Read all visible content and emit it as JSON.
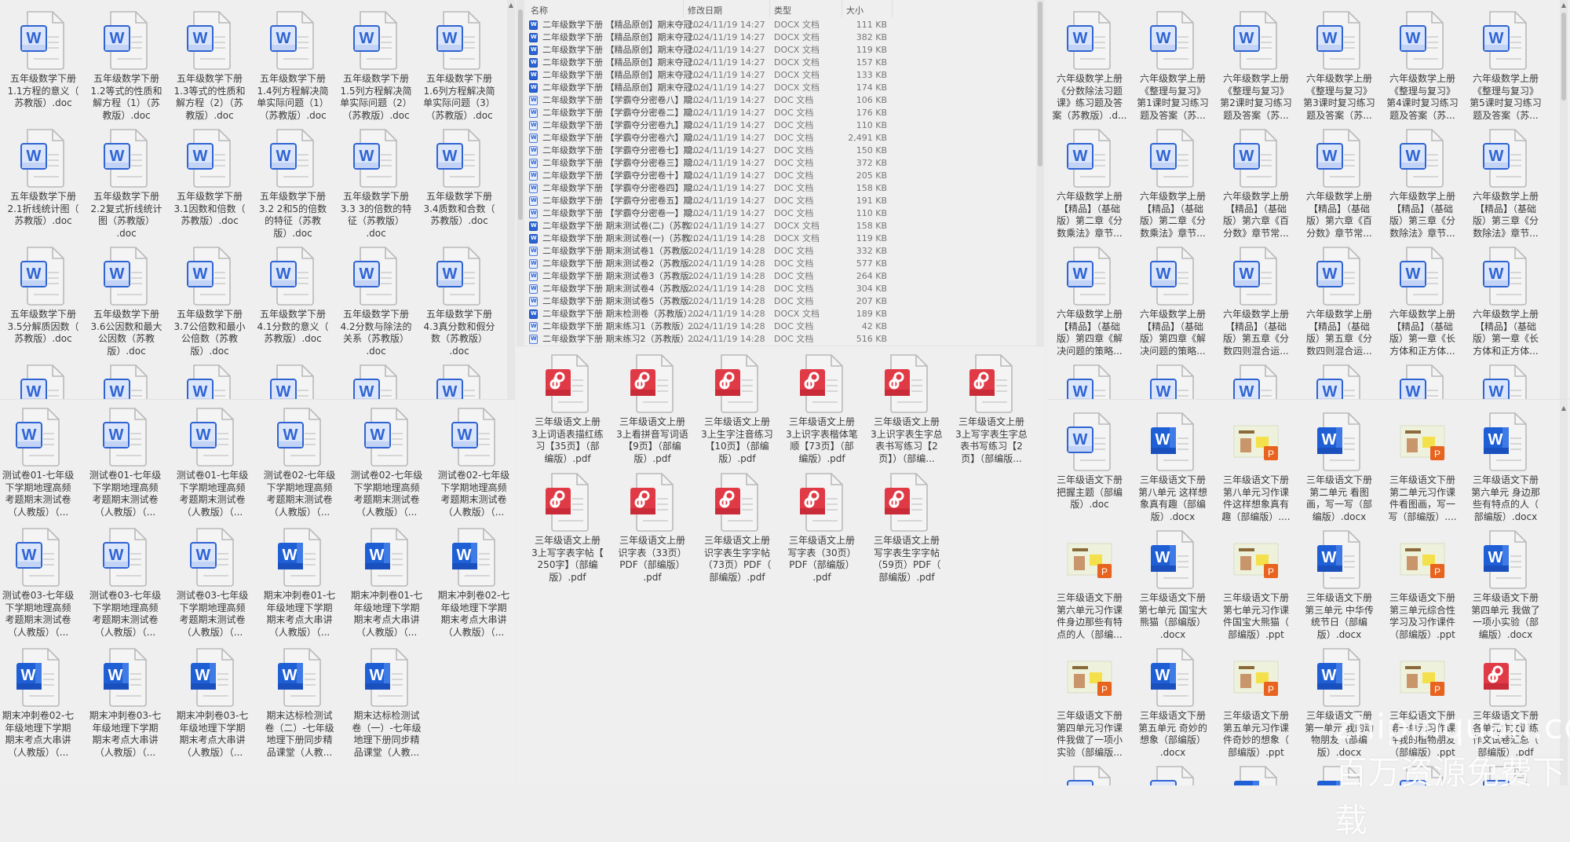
{
  "colors": {
    "word_blue": "#2f64d2",
    "pdf_red": "#e03a46",
    "ppt_orange": "#e8631f",
    "background": "#efefef"
  },
  "left_top": {
    "items": [
      {
        "icon": "word-light",
        "name": "五年级数学下册\n1.1方程的意义（\n苏教版）.doc"
      },
      {
        "icon": "word-light",
        "name": "五年级数学下册\n1.2等式的性质和\n解方程（1）（苏\n教版）.doc"
      },
      {
        "icon": "word-light",
        "name": "五年级数学下册\n1.3等式的性质和\n解方程（2）（苏\n教版）.doc"
      },
      {
        "icon": "word-light",
        "name": "五年级数学下册\n1.4列方程解决简\n单实际问题（1）\n（苏教版）.doc"
      },
      {
        "icon": "word-light",
        "name": "五年级数学下册\n1.5列方程解决简\n单实际问题（2）\n（苏教版）.doc"
      },
      {
        "icon": "word-light",
        "name": "五年级数学下册\n1.6列方程解决简\n单实际问题（3）\n（苏教版）.doc"
      },
      {
        "icon": "word-light",
        "name": "五年级数学下册\n2.1折线统计图（\n苏教版）.doc"
      },
      {
        "icon": "word-light",
        "name": "五年级数学下册\n2.2复式折线统计\n图（苏教版）\n.doc"
      },
      {
        "icon": "word-light",
        "name": "五年级数学下册\n3.1因数和倍数（\n苏教版）.doc"
      },
      {
        "icon": "word-light",
        "name": "五年级数学下册\n3.2 2和5的倍数\n的特征（苏教\n版）.doc"
      },
      {
        "icon": "word-light",
        "name": "五年级数学下册\n3.3 3的倍数的特\n征（苏教版）\n.doc"
      },
      {
        "icon": "word-light",
        "name": "五年级数学下册\n3.4质数和合数（\n苏教版）.doc"
      },
      {
        "icon": "word-light",
        "name": "五年级数学下册\n3.5分解质因数（\n苏教版）.doc"
      },
      {
        "icon": "word-light",
        "name": "五年级数学下册\n3.6公因数和最大\n公因数（苏教\n版）.doc"
      },
      {
        "icon": "word-light",
        "name": "五年级数学下册\n3.7公倍数和最小\n公倍数（苏教\n版）.doc"
      },
      {
        "icon": "word-light",
        "name": "五年级数学下册\n4.1分数的意义（\n苏教版）.doc"
      },
      {
        "icon": "word-light",
        "name": "五年级数学下册\n4.2分数与除法的\n关系（苏教版）\n.doc"
      },
      {
        "icon": "word-light",
        "name": "五年级数学下册\n4.3真分数和假分\n数（苏教版）\n.doc"
      },
      {
        "icon": "word-light"
      },
      {
        "icon": "word-light"
      },
      {
        "icon": "word-light"
      },
      {
        "icon": "word-light"
      },
      {
        "icon": "word-light"
      },
      {
        "icon": "word-light"
      }
    ]
  },
  "left_bottom": {
    "items": [
      {
        "icon": "word-light",
        "name": "测试卷01-七年级\n下学期地理高频\n考题期末测试卷\n（人教版）（..."
      },
      {
        "icon": "word-light",
        "name": "测试卷01-七年级\n下学期地理高频\n考题期末测试卷\n（人教版）（..."
      },
      {
        "icon": "word-light",
        "name": "测试卷01-七年级\n下学期地理高频\n考题期末测试卷\n（人教版）（..."
      },
      {
        "icon": "word-light",
        "name": "测试卷02-七年级\n下学期地理高频\n考题期末测试卷\n（人教版）（..."
      },
      {
        "icon": "word-light",
        "name": "测试卷02-七年级\n下学期地理高频\n考题期末测试卷\n（人教版）（..."
      },
      {
        "icon": "word-light",
        "name": "测试卷02-七年级\n下学期地理高频\n考题期末测试卷\n（人教版）（..."
      },
      {
        "icon": "word-light",
        "name": "测试卷03-七年级\n下学期地理高频\n考题期末测试卷\n（人教版）（..."
      },
      {
        "icon": "word-light",
        "name": "测试卷03-七年级\n下学期地理高频\n考题期末测试卷\n（人教版）（..."
      },
      {
        "icon": "word-light",
        "name": "测试卷03-七年级\n下学期地理高频\n考题期末测试卷\n（人教版）（..."
      },
      {
        "icon": "word-solid",
        "name": "期末冲刺卷01-七\n年级地理下学期\n期末考点大串讲\n（人教版）（..."
      },
      {
        "icon": "word-solid",
        "name": "期末冲刺卷01-七\n年级地理下学期\n期末考点大串讲\n（人教版）（..."
      },
      {
        "icon": "word-solid",
        "name": "期末冲刺卷02-七\n年级地理下学期\n期末考点大串讲\n（人教版）（..."
      },
      {
        "icon": "word-solid",
        "name": "期末冲刺卷02-七\n年级地理下学期\n期末考点大串讲\n（人教版）（..."
      },
      {
        "icon": "word-solid",
        "name": "期末冲刺卷03-七\n年级地理下学期\n期末考点大串讲\n（人教版）（..."
      },
      {
        "icon": "word-solid",
        "name": "期末冲刺卷03-七\n年级地理下学期\n期末考点大串讲\n（人教版）（..."
      },
      {
        "icon": "word-solid",
        "name": "期末达标检测试\n卷（二）-七年级\n地理下册同步精\n品课堂（人教..."
      },
      {
        "icon": "word-solid",
        "name": "期末达标检测试\n卷（一）-七年级\n地理下册同步精\n品课堂（人教..."
      }
    ]
  },
  "file_list": {
    "columns": {
      "name": "名称",
      "date": "修改日期",
      "type": "类型",
      "size": "大小"
    },
    "rows": [
      {
        "icon": "docx",
        "name": "二年级数学下册  【精品原创】期末夺冠...",
        "date": "2024/11/19 14:27",
        "type": "DOCX 文档",
        "size": "111 KB"
      },
      {
        "icon": "docx",
        "name": "二年级数学下册  【精品原创】期末夺冠...",
        "date": "2024/11/19 14:27",
        "type": "DOCX 文档",
        "size": "382 KB"
      },
      {
        "icon": "docx",
        "name": "二年级数学下册  【精品原创】期末夺冠...",
        "date": "2024/11/19 14:27",
        "type": "DOCX 文档",
        "size": "119 KB"
      },
      {
        "icon": "docx",
        "name": "二年级数学下册  【精品原创】期末夺冠...",
        "date": "2024/11/19 14:27",
        "type": "DOCX 文档",
        "size": "157 KB"
      },
      {
        "icon": "docx",
        "name": "二年级数学下册  【精品原创】期末夺冠...",
        "date": "2024/11/19 14:27",
        "type": "DOCX 文档",
        "size": "133 KB"
      },
      {
        "icon": "docx",
        "name": "二年级数学下册  【精品原创】期末夺冠...",
        "date": "2024/11/19 14:27",
        "type": "DOCX 文档",
        "size": "174 KB"
      },
      {
        "icon": "doc",
        "name": "二年级数学下册  【学霸夺分密卷八】期...",
        "date": "2024/11/19 14:27",
        "type": "DOC 文档",
        "size": "106 KB"
      },
      {
        "icon": "doc",
        "name": "二年级数学下册  【学霸夺分密卷二】期...",
        "date": "2024/11/19 14:27",
        "type": "DOC 文档",
        "size": "176 KB"
      },
      {
        "icon": "doc",
        "name": "二年级数学下册  【学霸夺分密卷九】期...",
        "date": "2024/11/19 14:27",
        "type": "DOC 文档",
        "size": "110 KB"
      },
      {
        "icon": "doc",
        "name": "二年级数学下册  【学霸夺分密卷六】期...",
        "date": "2024/11/19 14:27",
        "type": "DOC 文档",
        "size": "2,491 KB"
      },
      {
        "icon": "doc",
        "name": "二年级数学下册  【学霸夺分密卷七】期...",
        "date": "2024/11/19 14:27",
        "type": "DOC 文档",
        "size": "150 KB"
      },
      {
        "icon": "doc",
        "name": "二年级数学下册  【学霸夺分密卷三】期...",
        "date": "2024/11/19 14:27",
        "type": "DOC 文档",
        "size": "372 KB"
      },
      {
        "icon": "doc",
        "name": "二年级数学下册  【学霸夺分密卷十】期...",
        "date": "2024/11/19 14:27",
        "type": "DOC 文档",
        "size": "205 KB"
      },
      {
        "icon": "doc",
        "name": "二年级数学下册  【学霸夺分密卷四】期...",
        "date": "2024/11/19 14:27",
        "type": "DOC 文档",
        "size": "158 KB"
      },
      {
        "icon": "doc",
        "name": "二年级数学下册  【学霸夺分密卷五】期...",
        "date": "2024/11/19 14:27",
        "type": "DOC 文档",
        "size": "191 KB"
      },
      {
        "icon": "doc",
        "name": "二年级数学下册  【学霸夺分密卷一】期...",
        "date": "2024/11/19 14:27",
        "type": "DOC 文档",
        "size": "110 KB"
      },
      {
        "icon": "docx",
        "name": "二年级数学下册  期末测试卷(二)（苏教...",
        "date": "2024/11/19 14:27",
        "type": "DOCX 文档",
        "size": "158 KB"
      },
      {
        "icon": "docx",
        "name": "二年级数学下册  期末测试卷(一)（苏教...",
        "date": "2024/11/19 14:28",
        "type": "DOCX 文档",
        "size": "119 KB"
      },
      {
        "icon": "doc",
        "name": "二年级数学下册  期末测试卷1（苏教版...",
        "date": "2024/11/19 14:28",
        "type": "DOC 文档",
        "size": "332 KB"
      },
      {
        "icon": "doc",
        "name": "二年级数学下册  期末测试卷2（苏教版...",
        "date": "2024/11/19 14:28",
        "type": "DOC 文档",
        "size": "577 KB"
      },
      {
        "icon": "doc",
        "name": "二年级数学下册  期末测试卷3（苏教版...",
        "date": "2024/11/19 14:28",
        "type": "DOC 文档",
        "size": "264 KB"
      },
      {
        "icon": "doc",
        "name": "二年级数学下册  期末测试卷4（苏教版...",
        "date": "2024/11/19 14:28",
        "type": "DOC 文档",
        "size": "304 KB"
      },
      {
        "icon": "doc",
        "name": "二年级数学下册  期末测试卷5（苏教版...",
        "date": "2024/11/19 14:28",
        "type": "DOC 文档",
        "size": "207 KB"
      },
      {
        "icon": "docx",
        "name": "二年级数学下册  期末检测卷（苏教版）....",
        "date": "2024/11/19 14:28",
        "type": "DOCX 文档",
        "size": "189 KB"
      },
      {
        "icon": "doc",
        "name": "二年级数学下册  期末练习1（苏教版）....",
        "date": "2024/11/19 14:28",
        "type": "DOC 文档",
        "size": "42 KB"
      },
      {
        "icon": "doc",
        "name": "二年级数学下册  期末练习2（苏教版）....",
        "date": "2024/11/19 14:28",
        "type": "DOC 文档",
        "size": "516 KB"
      }
    ]
  },
  "middle_bottom": {
    "items": [
      {
        "icon": "pdf",
        "name": "三年级语文上册\n3上词语表描红练\n习【35页】（部\n编版）.pdf"
      },
      {
        "icon": "pdf",
        "name": "三年级语文上册\n3上看拼音写词语\n【9页】（部编\n版）.pdf"
      },
      {
        "icon": "pdf",
        "name": "三年级语文上册\n3上生字注音练习\n【10页】（部编\n版）.pdf"
      },
      {
        "icon": "pdf",
        "name": "三年级语文上册\n3上识字表楷体笔\n顺【73页】（部\n编版）.pdf"
      },
      {
        "icon": "pdf",
        "name": "三年级语文上册\n3上识字表生字总\n表书写练习【2\n页】）（部编..."
      },
      {
        "icon": "pdf",
        "name": "三年级语文上册\n3上写字表生字总\n表书写练习【2\n页】（部编版..."
      },
      {
        "icon": "pdf",
        "name": "三年级语文上册\n3上写字表字帖【\n250字】（部编\n版）.pdf"
      },
      {
        "icon": "pdf",
        "name": "三年级语文上册\n识字表（33页）\nPDF（部编版）\n.pdf"
      },
      {
        "icon": "pdf",
        "name": "三年级语文上册\n识字表生字字帖\n（73页）PDF（\n部编版）.pdf"
      },
      {
        "icon": "pdf",
        "name": "三年级语文上册\n写字表（30页）\nPDF（部编版）\n.pdf"
      },
      {
        "icon": "pdf",
        "name": "三年级语文上册\n写字表生字字帖\n（59页）PDF（\n部编版）.pdf"
      }
    ]
  },
  "right_top": {
    "items": [
      {
        "icon": "word-light",
        "name": "六年级数学上册\n《分数除法习题\n课》练习题及答\n案（苏教版）.d..."
      },
      {
        "icon": "word-light",
        "name": "六年级数学上册\n《整理与复习》\n第1课时复习练习\n题及答案（苏..."
      },
      {
        "icon": "word-light",
        "name": "六年级数学上册\n《整理与复习》\n第2课时复习练习\n题及答案（苏..."
      },
      {
        "icon": "word-light",
        "name": "六年级数学上册\n《整理与复习》\n第3课时复习练习\n题及答案（苏..."
      },
      {
        "icon": "word-light",
        "name": "六年级数学上册\n《整理与复习》\n第4课时复习练习\n题及答案（苏..."
      },
      {
        "icon": "word-light",
        "name": "六年级数学上册\n《整理与复习》\n第5课时复习练习\n题及答案（苏..."
      },
      {
        "icon": "word-light",
        "name": "六年级数学上册\n【精品】（基础\n版）第二章《分\n数乘法》章节..."
      },
      {
        "icon": "word-light",
        "name": "六年级数学上册\n【精品】（基础\n版）第二章《分\n数乘法》章节..."
      },
      {
        "icon": "word-light",
        "name": "六年级数学上册\n【精品】（基础\n版）第六章《百\n分数》章节常..."
      },
      {
        "icon": "word-light",
        "name": "六年级数学上册\n【精品】（基础\n版）第六章《百\n分数》章节常..."
      },
      {
        "icon": "word-light",
        "name": "六年级数学上册\n【精品】（基础\n版）第三章《分\n数除法》章节..."
      },
      {
        "icon": "word-light",
        "name": "六年级数学上册\n【精品】（基础\n版）第三章《分\n数除法》章节..."
      },
      {
        "icon": "word-light",
        "name": "六年级数学上册\n【精品】（基础\n版）第四章《解\n决问题的策略..."
      },
      {
        "icon": "word-light",
        "name": "六年级数学上册\n【精品】（基础\n版）第四章《解\n决问题的策略..."
      },
      {
        "icon": "word-light",
        "name": "六年级数学上册\n【精品】（基础\n版）第五章《分\n数四则混合运..."
      },
      {
        "icon": "word-light",
        "name": "六年级数学上册\n【精品】（基础\n版）第五章《分\n数四则混合运..."
      },
      {
        "icon": "word-light",
        "name": "六年级数学上册\n【精品】（基础\n版）第一章《长\n方体和正方体..."
      },
      {
        "icon": "word-light",
        "name": "六年级数学上册\n【精品】（基础\n版）第一章《长\n方体和正方体..."
      },
      {
        "icon": "word-light"
      },
      {
        "icon": "word-light"
      },
      {
        "icon": "word-light"
      },
      {
        "icon": "word-light"
      },
      {
        "icon": "word-light"
      },
      {
        "icon": "word-light"
      }
    ]
  },
  "right_bottom": {
    "items": [
      {
        "icon": "word-light",
        "name": "三年级语文下册\n把握主题（部编\n版）.doc"
      },
      {
        "icon": "word-solid",
        "name": "三年级语文下册\n第八单元 这样想\n象真有趣（部编\n版）.docx"
      },
      {
        "icon": "ppt",
        "name": "三年级语文下册\n第八单元习作课\n件这样想象真有\n趣（部编版）...."
      },
      {
        "icon": "word-solid",
        "name": "三年级语文下册\n第二单元 看图\n画，写一写（部\n编版）.docx"
      },
      {
        "icon": "ppt",
        "name": "三年级语文下册\n第二单元习作课\n件看图画，写一\n写（部编版）...."
      },
      {
        "icon": "word-solid",
        "name": "三年级语文下册\n第六单元 身边那\n些有特点的人（\n部编版）.docx"
      },
      {
        "icon": "ppt",
        "name": "三年级语文下册\n第六单元习作课\n件身边那些有特\n点的人（部编..."
      },
      {
        "icon": "word-solid",
        "name": "三年级语文下册\n第七单元 国宝大\n熊猫（部编版）\n.docx"
      },
      {
        "icon": "ppt",
        "name": "三年级语文下册\n第七单元习作课\n件国宝大熊猫（\n部编版）.ppt"
      },
      {
        "icon": "word-solid",
        "name": "三年级语文下册\n第三单元 中华传\n统节日（部编\n版）.docx"
      },
      {
        "icon": "ppt",
        "name": "三年级语文下册\n第三单元综合性\n学习及习作课件\n（部编版）.ppt"
      },
      {
        "icon": "word-solid",
        "name": "三年级语文下册\n第四单元 我做了\n一项小实验（部\n编版）.docx"
      },
      {
        "icon": "ppt",
        "name": "三年级语文下册\n第四单元习作课\n件我做了一项小\n实验（部编版..."
      },
      {
        "icon": "word-solid",
        "name": "三年级语文下册\n第五单元 奇妙的\n想象（部编版）\n.docx"
      },
      {
        "icon": "ppt",
        "name": "三年级语文下册\n第五单元习作课\n件奇妙的想象（\n部编版）.ppt"
      },
      {
        "icon": "word-solid",
        "name": "三年级语文下册\n第一单元 我的动\n物朋友（部编\n版）.docx"
      },
      {
        "icon": "ppt",
        "name": "三年级语文下册\n第一单元习作课\n件我的植物朋友\n（部编版）.ppt"
      },
      {
        "icon": "pdf",
        "name": "三年级语文下册\n各单元作文训练\n作文试卷汇总（\n部编版）.pdf"
      },
      {
        "icon": "word-light"
      },
      {
        "icon": "word-light"
      },
      {
        "icon": "word-solid"
      },
      {
        "icon": "word-solid"
      },
      {
        "icon": "word-light"
      },
      {
        "icon": "word-light"
      }
    ]
  },
  "watermark": {
    "line1": "zhipinquan.com",
    "line2": "百万资源免费下载"
  }
}
